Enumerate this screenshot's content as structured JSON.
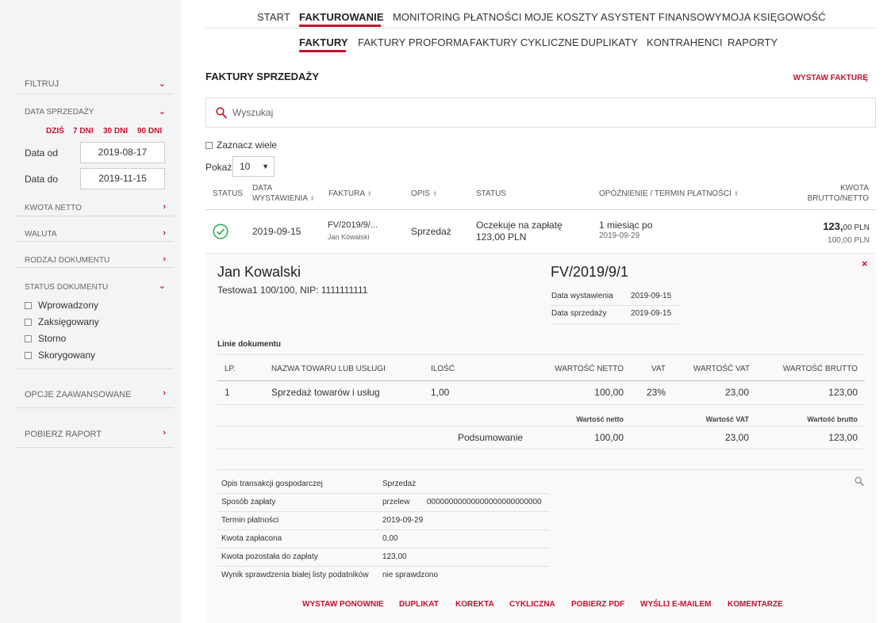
{
  "colors": {
    "accent": "#c8102e",
    "success": "#2ca84c",
    "sidebar_bg": "#f4f4f4"
  },
  "nav": {
    "top": [
      "START",
      "FAKTUROWANIE",
      "MONITORING PŁATNOŚCI",
      "MOJE KOSZTY",
      "ASYSTENT FINANSOWY",
      "MOJA KSIĘGOWOŚĆ"
    ],
    "sub": [
      "FAKTURY",
      "FAKTURY PROFORMA",
      "FAKTURY CYKLICZNE",
      "DUPLIKATY",
      "KONTRAHENCI",
      "RAPORTY"
    ]
  },
  "sidebar": {
    "filtruj": "FILTRUJ",
    "data_sprzedazy": "DATA SPRZEDAŻY",
    "quick": [
      "DZIŚ",
      "7 DNI",
      "30 DNI",
      "90 DNI"
    ],
    "date_from_label": "Data od",
    "date_from": "2019-08-17",
    "date_to_label": "Data do",
    "date_to": "2019-11-15",
    "kwota_netto": "KWOTA NETTO",
    "waluta": "WALUTA",
    "rodzaj": "RODZAJ DOKUMENTU",
    "status": "STATUS DOKUMENTU",
    "statuses": [
      "Wprowadzony",
      "Zaksięgowany",
      "Storno",
      "Skorygowany"
    ],
    "opcje": "OPCJE ZAAWANSOWANE",
    "raport": "POBIERZ RAPORT"
  },
  "page": {
    "title": "FAKTURY SPRZEDAŻY",
    "wystaw": "WYSTAW FAKTURĘ",
    "search_placeholder": "Wyszukaj",
    "zaznacz": "Zaznacz wiele",
    "pokaz": "Pokaż",
    "pokaz_value": "10"
  },
  "table": {
    "headers": {
      "status": "STATUS",
      "data1": "DATA",
      "data2": "WYSTAWIENIA",
      "faktura": "FAKTURA",
      "opis": "OPIS",
      "status2": "STATUS",
      "opoznienie": "OPÓŹNIENIE / TERMIN PŁATNOŚCI",
      "kwota1": "KWOTA",
      "kwota2": "BRUTTO/NETTO"
    },
    "row": {
      "date": "2019-09-15",
      "invoice": "FV/2019/9/...",
      "client": "Jan Kowalski",
      "opis": "Sprzedaż",
      "status": "Oczekuje na zapłatę",
      "status_amount": "123,00 PLN",
      "delay": "1 miesiąc po",
      "due": "2019-09-29",
      "brutto_main": "123,",
      "brutto_dec": "00 PLN",
      "netto": "100,00 PLN"
    }
  },
  "detail": {
    "name": "Jan Kowalski",
    "address": "Testowa1 100/100, NIP: 1111111111",
    "invoice": "FV/2019/9/1",
    "issue_label": "Data wystawienia",
    "issue_date": "2019-09-15",
    "sale_label": "Data sprzedaży",
    "sale_date": "2019-09-15",
    "close": "×",
    "lines_title": "Linie dokumentu",
    "lines_headers": [
      "LP.",
      "NAZWA TOWARU LUB USŁUGI",
      "ILOŚĆ",
      "WARTOŚĆ NETTO",
      "VAT",
      "WARTOŚĆ VAT",
      "WARTOŚĆ BRUTTO"
    ],
    "line": {
      "lp": "1",
      "name": "Sprzedaż towarów i usług",
      "qty": "1,00",
      "net": "100,00",
      "vat": "23%",
      "vat_val": "23,00",
      "gross": "123,00"
    },
    "summary_headers": [
      "Wartość netto",
      "Wartość VAT",
      "Wartość brutto"
    ],
    "summary": {
      "label": "Podsumowanie",
      "net": "100,00",
      "vat": "23,00",
      "gross": "123,00"
    },
    "info": [
      {
        "label": "Opis transakcji gospodarczej",
        "value": "Sprzedaż",
        "extra": ""
      },
      {
        "label": "Sposób zapłaty",
        "value": "przelew",
        "extra": "00000000000000000000000000"
      },
      {
        "label": "Termin płatności",
        "value": "2019-09-29",
        "extra": ""
      },
      {
        "label": "Kwota zapłacona",
        "value": "0,00",
        "extra": ""
      },
      {
        "label": "Kwota pozostała do zapłaty",
        "value": "123,00",
        "extra": ""
      },
      {
        "label": "Wynik sprawdzenia białej listy podatników",
        "value": "nie sprawdzono",
        "extra": ""
      }
    ],
    "actions": [
      "WYSTAW PONOWNIE",
      "DUPLIKAT",
      "KOREKTA",
      "CYKLICZNA",
      "POBIERZ PDF",
      "WYŚLIJ E-MAILEM",
      "KOMENTARZE"
    ]
  }
}
